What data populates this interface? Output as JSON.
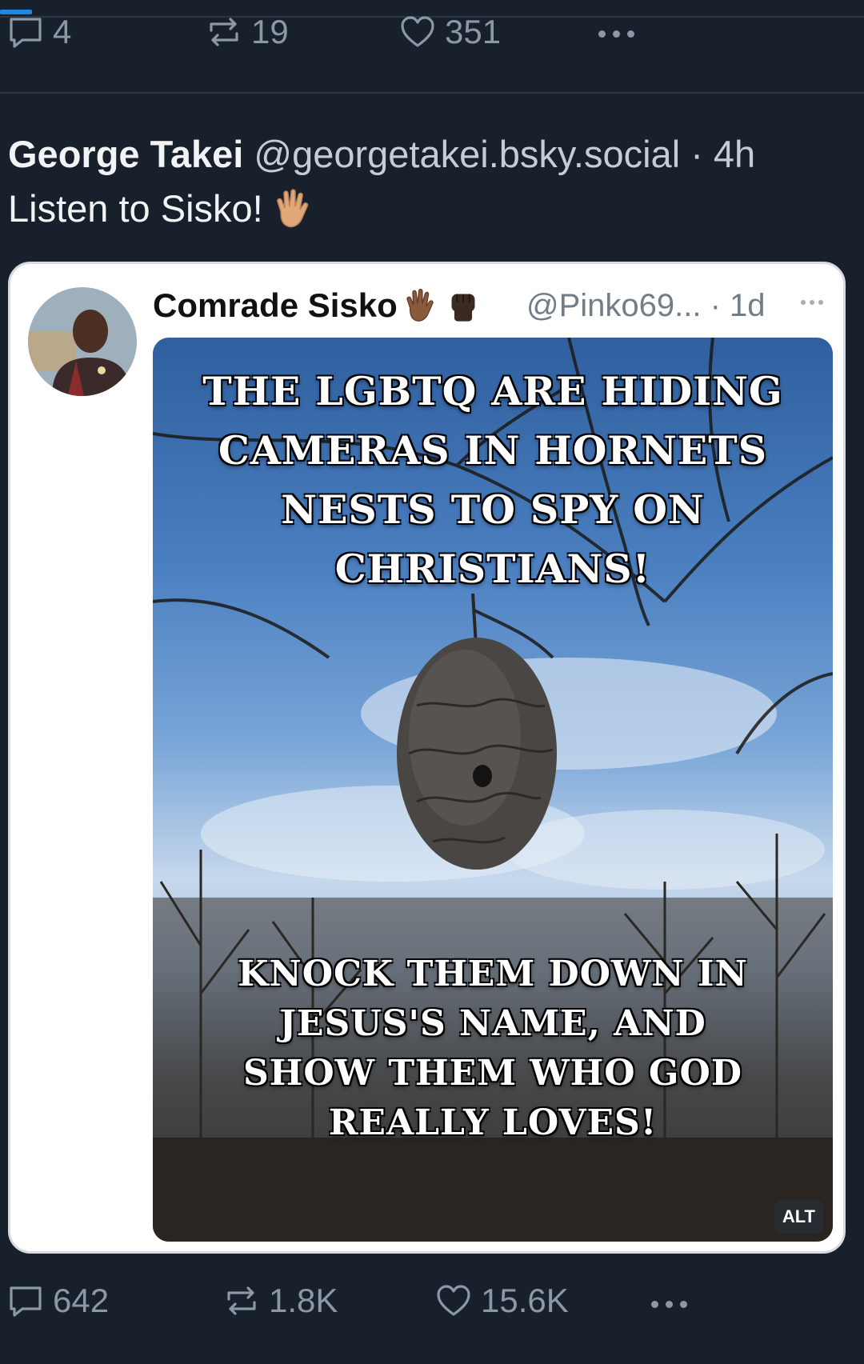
{
  "top_actions": {
    "replies": "4",
    "reposts": "19",
    "likes": "351"
  },
  "post": {
    "author_name": "George Takei",
    "author_handle": "@georgetakei.bsky.social · 4h",
    "text": "Listen to Sisko!"
  },
  "quote": {
    "author_name": "Comrade Sisko",
    "author_handle": "@Pinko69... · 1d",
    "image_alt_badge": "ALT",
    "meme_top_lines": [
      "THE LGBTQ ARE HIDING",
      "CAMERAS IN HORNETS",
      "NESTS TO SPY ON",
      "CHRISTIANS!"
    ],
    "meme_bottom_lines": [
      "KNOCK THEM DOWN IN",
      "JESUS'S NAME, AND",
      "SHOW THEM WHO GOD",
      "REALLY LOVES!"
    ]
  },
  "bottom_actions": {
    "replies": "642",
    "reposts": "1.8K",
    "likes": "15.6K"
  },
  "colors": {
    "background": "#17202b",
    "muted": "#8b98a6",
    "accent": "#1e88e5"
  }
}
